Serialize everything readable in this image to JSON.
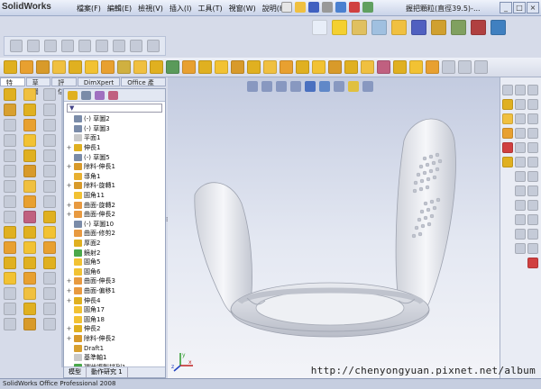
{
  "app": {
    "name": "SolidWorks"
  },
  "menu": [
    "檔案(F)",
    "編輯(E)",
    "檢視(V)",
    "插入(I)",
    "工具(T)",
    "視窗(W)",
    "說明(H)"
  ],
  "document_title": "握把顆粒(直徑39.5)-...",
  "window_buttons": {
    "min": "_",
    "max": "□",
    "close": "×"
  },
  "command_tabs": [
    "特徵",
    "草圖",
    "評估",
    "DimXpert",
    "Office 產品"
  ],
  "feature_manager": {
    "filter_symbol": "▼",
    "tree": [
      {
        "label": "(-) 草圖2",
        "expand": "",
        "color": "#7a8ba8"
      },
      {
        "label": "(-) 草圖3",
        "expand": "",
        "color": "#7a8ba8"
      },
      {
        "label": "平面1",
        "expand": "",
        "color": "#c9c9c9"
      },
      {
        "label": "伸長1",
        "expand": "+",
        "color": "#e0b020"
      },
      {
        "label": "(-) 草圖5",
        "expand": "",
        "color": "#7a8ba8"
      },
      {
        "label": "除料-伸長1",
        "expand": "+",
        "color": "#d89a2a"
      },
      {
        "label": "導角1",
        "expand": "",
        "color": "#e8b030"
      },
      {
        "label": "除料-旋轉1",
        "expand": "+",
        "color": "#d89a2a"
      },
      {
        "label": "圓角11",
        "expand": "",
        "color": "#f2c233"
      },
      {
        "label": "曲面-旋轉2",
        "expand": "+",
        "color": "#e89a40"
      },
      {
        "label": "曲面-伸長2",
        "expand": "+",
        "color": "#e89a40"
      },
      {
        "label": "(-) 草圖10",
        "expand": "",
        "color": "#7a8ba8"
      },
      {
        "label": "曲面-修剪2",
        "expand": "",
        "color": "#e89a40"
      },
      {
        "label": "厚面2",
        "expand": "",
        "color": "#e0b020"
      },
      {
        "label": "鏡射2",
        "expand": "",
        "color": "#4aa84a"
      },
      {
        "label": "圓角5",
        "expand": "",
        "color": "#f2c233"
      },
      {
        "label": "圓角6",
        "expand": "",
        "color": "#f2c233"
      },
      {
        "label": "曲面-伸長3",
        "expand": "+",
        "color": "#e89a40"
      },
      {
        "label": "曲面-偏移1",
        "expand": "+",
        "color": "#e89a40"
      },
      {
        "label": "伸長4",
        "expand": "+",
        "color": "#e0b020"
      },
      {
        "label": "圓角17",
        "expand": "",
        "color": "#f2c233"
      },
      {
        "label": "圓角18",
        "expand": "",
        "color": "#f2c233"
      },
      {
        "label": "伸長2",
        "expand": "+",
        "color": "#e0b020"
      },
      {
        "label": "除料-伸長2",
        "expand": "+",
        "color": "#d89a2a"
      },
      {
        "label": "Draft1",
        "expand": "",
        "color": "#d8a030"
      },
      {
        "label": "基準軸1",
        "expand": "",
        "color": "#c9c9c9"
      },
      {
        "label": "環狀複製排列1",
        "expand": "",
        "color": "#4aa84a"
      }
    ],
    "bottom_tabs": [
      "模型",
      "動作研究 1"
    ]
  },
  "viewport": {
    "triad_labels": {
      "x": "x",
      "y": "y",
      "z": "z"
    }
  },
  "status_bar": {
    "text": "SolidWorks Office Professional 2008"
  },
  "watermark": "http://chenyongyuan.pixnet.net/album",
  "colors": {
    "accent": "#e0b020",
    "menu_bg": "#c9d3e8",
    "viewport_top": "#c3cbe0"
  }
}
